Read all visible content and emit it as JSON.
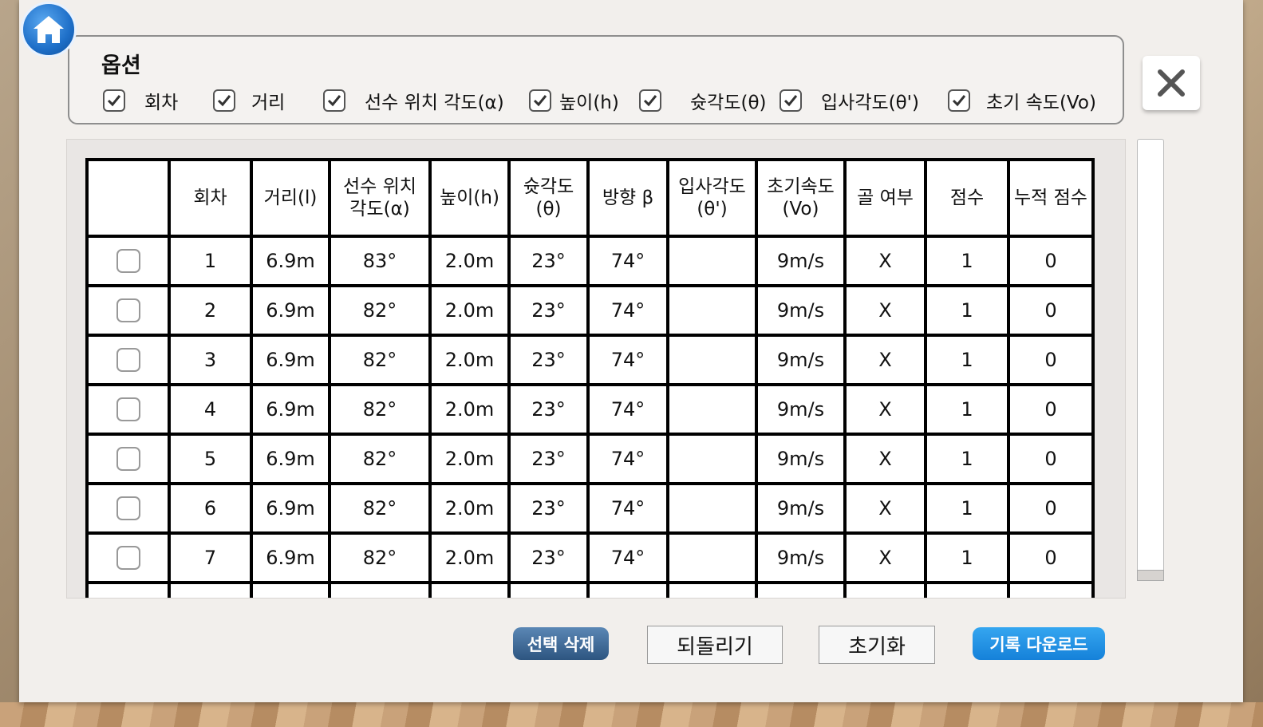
{
  "options": {
    "title": "옵션",
    "items": [
      {
        "label": "회차",
        "checked": true
      },
      {
        "label": "거리",
        "checked": true
      },
      {
        "label": "선수 위치 각도(α)",
        "checked": true
      },
      {
        "label": "높이(h)",
        "checked": true
      },
      {
        "label": "",
        "checked": true
      },
      {
        "label": "슛각도(θ)",
        "checked": true
      },
      {
        "label": "입사각도(θ')",
        "checked": true
      },
      {
        "label": "초기 속도(Vo)",
        "checked": true
      }
    ]
  },
  "table": {
    "headers": [
      "",
      "회차",
      "거리(l)",
      "선수 위치\n각도(α)",
      "높이(h)",
      "슛각도\n(θ)",
      "방향 β",
      "입사각도\n(θ')",
      "초기속도\n(Vo)",
      "골 여부",
      "점수",
      "누적 점수"
    ],
    "rows": [
      [
        "1",
        "6.9m",
        "83°",
        "2.0m",
        "23°",
        "74°",
        "",
        "9m/s",
        "X",
        "1",
        "0"
      ],
      [
        "2",
        "6.9m",
        "82°",
        "2.0m",
        "23°",
        "74°",
        "",
        "9m/s",
        "X",
        "1",
        "0"
      ],
      [
        "3",
        "6.9m",
        "82°",
        "2.0m",
        "23°",
        "74°",
        "",
        "9m/s",
        "X",
        "1",
        "0"
      ],
      [
        "4",
        "6.9m",
        "82°",
        "2.0m",
        "23°",
        "74°",
        "",
        "9m/s",
        "X",
        "1",
        "0"
      ],
      [
        "5",
        "6.9m",
        "82°",
        "2.0m",
        "23°",
        "74°",
        "",
        "9m/s",
        "X",
        "1",
        "0"
      ],
      [
        "6",
        "6.9m",
        "82°",
        "2.0m",
        "23°",
        "74°",
        "",
        "9m/s",
        "X",
        "1",
        "0"
      ],
      [
        "7",
        "6.9m",
        "82°",
        "2.0m",
        "23°",
        "74°",
        "",
        "9m/s",
        "X",
        "1",
        "0"
      ]
    ]
  },
  "buttons": {
    "delete_selected": "선택 삭제",
    "undo": "되돌리기",
    "reset": "초기화",
    "download": "기록 다운로드"
  },
  "icons": {
    "home": "home-icon",
    "close": "close-icon"
  },
  "colors": {
    "home_blue": "#1e6fc8",
    "delete_button": "#2d5580",
    "download_button": "#1581d9"
  }
}
